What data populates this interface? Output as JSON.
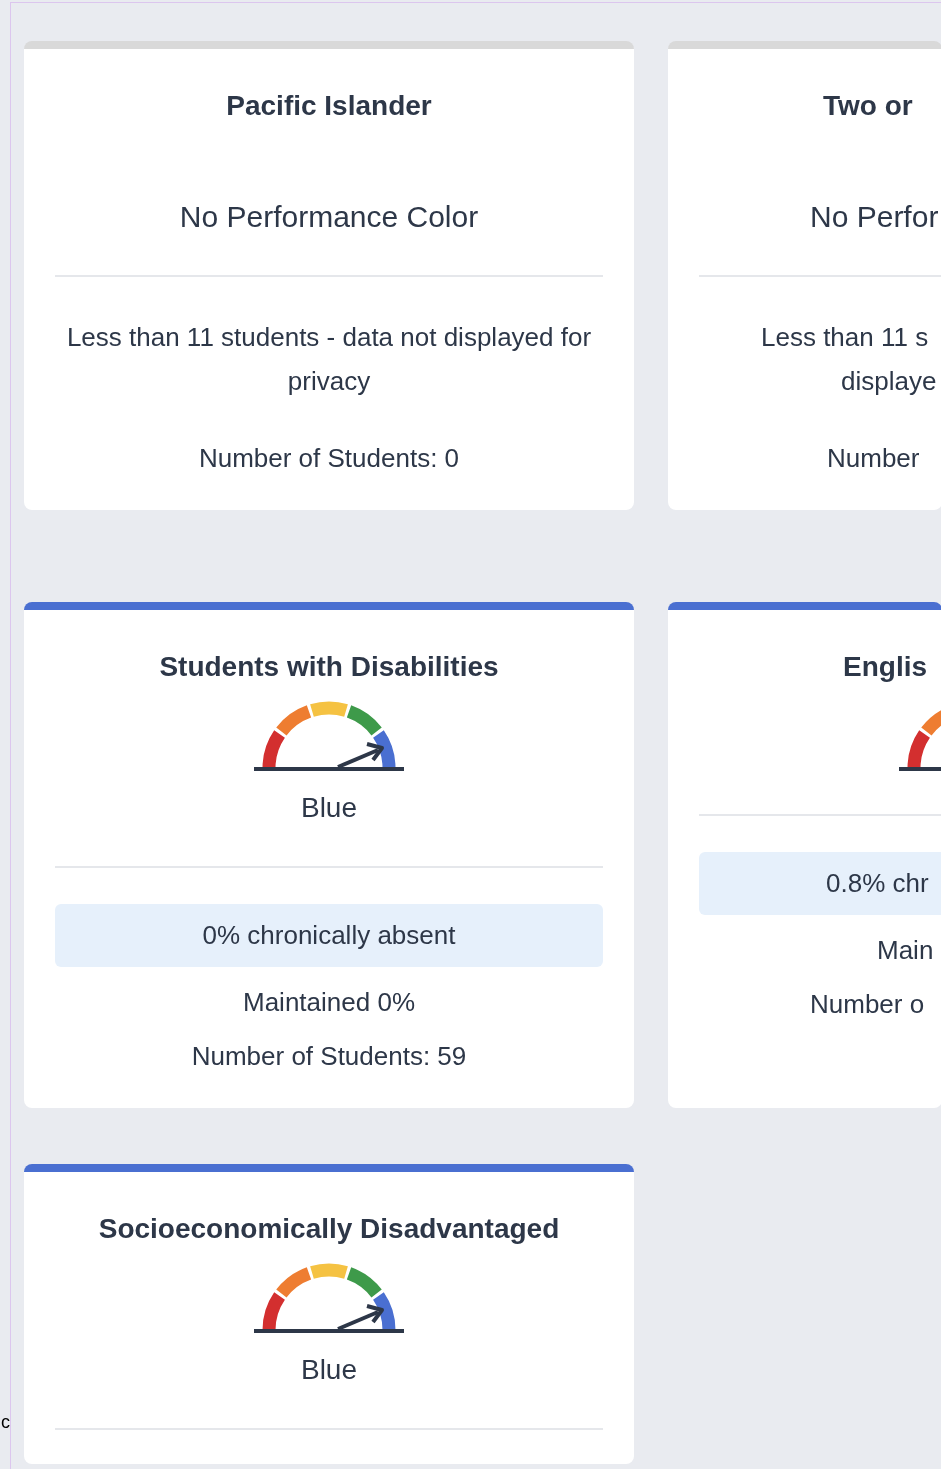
{
  "rows": [
    {
      "cards": [
        {
          "kind": "no_color",
          "title": "Pacific Islander",
          "status": "No Performance Color",
          "note_lines": [
            "Less than 11 students - data not displayed for privacy"
          ],
          "count": "Number of Students: 0"
        },
        {
          "kind": "no_color",
          "title": "Two or",
          "status": "No Perfor",
          "note_lines": [
            "Less than 11 s",
            "displaye"
          ],
          "count": "Number"
        }
      ]
    },
    {
      "cards": [
        {
          "kind": "gauge",
          "title": "Students with Disabilities",
          "status": "Blue",
          "absent": "0% chronically absent",
          "change": "Maintained 0%",
          "count": "Number of Students: 59"
        },
        {
          "kind": "gauge",
          "title": "Englis",
          "absent": "0.8% chr",
          "change": "Main",
          "count": "Number o"
        }
      ]
    },
    {
      "cards": [
        {
          "kind": "gauge",
          "title": "Socioeconomically Disadvantaged",
          "status": "Blue"
        }
      ]
    }
  ],
  "edge_text": "c"
}
